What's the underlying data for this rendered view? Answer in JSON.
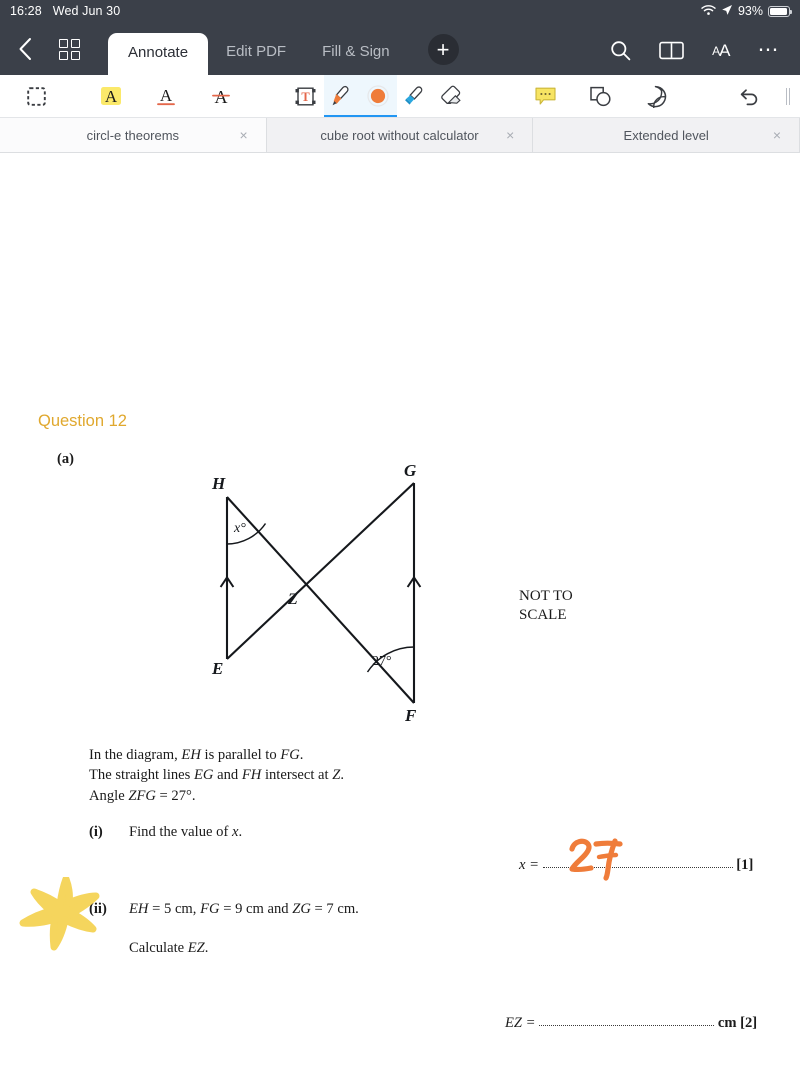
{
  "status_bar": {
    "time": "16:28",
    "date": "Wed Jun 30",
    "battery_percent": "93%",
    "icons": [
      "wifi-icon",
      "location-arrow-icon",
      "battery-icon"
    ]
  },
  "header": {
    "back_icon": "chevron-left-icon",
    "grid_icon": "grid-view-icon",
    "mode_tabs": [
      {
        "label": "Annotate",
        "active": true
      },
      {
        "label": "Edit PDF",
        "active": false
      },
      {
        "label": "Fill & Sign",
        "active": false
      }
    ],
    "add_label": "+",
    "right_icons": [
      "search-icon",
      "book-icon",
      "text-size-icon",
      "more-icon"
    ],
    "text_size_label": "AA"
  },
  "toolbar": {
    "tools": [
      {
        "name": "select-area-tool",
        "label": "Select area",
        "selected": false
      },
      {
        "name": "highlight-text-tool",
        "label": "Highlight",
        "selected": false
      },
      {
        "name": "underline-text-tool",
        "label": "Underline",
        "selected": false
      },
      {
        "name": "strikethrough-text-tool",
        "label": "Strikethrough",
        "selected": false
      },
      {
        "name": "text-box-tool",
        "label": "Text box",
        "selected": false
      },
      {
        "name": "pen-tool",
        "label": "Pen",
        "selected": true
      },
      {
        "name": "color-swatch-tool",
        "label": "Colour",
        "selected": true
      },
      {
        "name": "highlighter-pen-tool",
        "label": "Highlighter",
        "selected": false
      },
      {
        "name": "eraser-tool",
        "label": "Eraser",
        "selected": false
      },
      {
        "name": "comment-tool",
        "label": "Comment",
        "selected": false
      },
      {
        "name": "shapes-tool",
        "label": "Shapes",
        "selected": false
      },
      {
        "name": "sticker-tool",
        "label": "Sticker",
        "selected": false
      },
      {
        "name": "undo-button",
        "label": "Undo",
        "selected": false
      }
    ],
    "accent_color": "#2196f3",
    "pen_color": "#ef7c3a",
    "highlighter_color": "#f7e463",
    "eraser_color": "#e9ebed"
  },
  "document_tabs": [
    {
      "label": "circl-e theorems",
      "active": true,
      "close": "×"
    },
    {
      "label": "cube root without calculator",
      "active": false,
      "close": "×"
    },
    {
      "label": "Extended level",
      "active": false,
      "close": "×"
    }
  ],
  "page": {
    "question_title": "Question 12",
    "part_label": "(a)",
    "not_to_scale_line1": "NOT TO",
    "not_to_scale_line2": "SCALE",
    "statement_line1_pre": "In the diagram, ",
    "statement_line1_a": "EH",
    "statement_line1_mid": " is parallel to ",
    "statement_line1_b": "FG",
    "statement_line1_end": ".",
    "statement_line2_pre": "The straight lines ",
    "statement_line2_a": "EG",
    "statement_line2_mid": " and ",
    "statement_line2_b": "FH",
    "statement_line2_mid2": " intersect at ",
    "statement_line2_c": "Z",
    "statement_line2_end": ".",
    "statement_line3_pre": "Angle ",
    "statement_line3_a": "ZFG",
    "statement_line3_end": " = 27°.",
    "part_i_label": "(i)",
    "part_i_text_pre": "Find the value of ",
    "part_i_text_var": "x",
    "part_i_text_end": ".",
    "part_ii_label": "(ii)",
    "part_ii_seg1": "EH",
    "part_ii_seg1_val": " = 5 cm, ",
    "part_ii_seg2": "FG",
    "part_ii_seg2_val": " = 9 cm and ",
    "part_ii_seg3": "ZG",
    "part_ii_seg3_val": " = 7 cm.",
    "part_ii_calc_pre": "Calculate ",
    "part_ii_calc_var": "EZ",
    "part_ii_calc_end": ".",
    "answer_x_label": "x =",
    "answer_x_marks": "[1]",
    "answer_ez_label": "EZ =",
    "answer_ez_unit": "cm",
    "answer_ez_marks": "[2]"
  },
  "diagram": {
    "type": "geometry-figure",
    "vertex_labels": {
      "H": "H",
      "G": "G",
      "E": "E",
      "F": "F",
      "Z": "Z"
    },
    "angle_x_label": "x°",
    "angle_27_label": "27°",
    "parallel_marks": 2,
    "description": "Two parallel vertical segments EH and FG with transversals EG and FH meeting at Z"
  },
  "annotations": [
    {
      "name": "handwritten-answer-27",
      "tool": "pen",
      "text": "27",
      "color": "#ef7c3a"
    },
    {
      "name": "highlighter-star-scribble",
      "tool": "highlighter",
      "color": "#f5d251"
    }
  ]
}
